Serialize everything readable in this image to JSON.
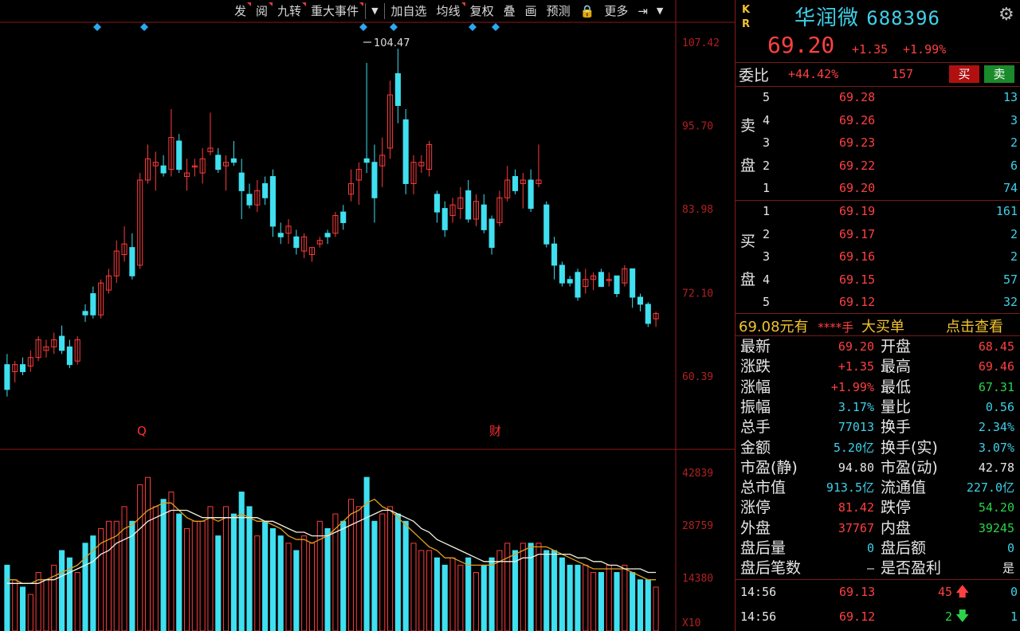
{
  "toolbar": {
    "items": [
      "发",
      "阅",
      "九转",
      "重大事件",
      "▼",
      "加自选",
      "均线",
      "复权",
      "叠",
      "画",
      "预测",
      "🔒",
      "更多",
      "⇥",
      "▼"
    ]
  },
  "chart": {
    "price_axis_labels": [
      "107.42",
      "95.70",
      "83.98",
      "72.10",
      "60.39"
    ],
    "volume_axis_labels": [
      "42839",
      "28759",
      "14380",
      "X10"
    ],
    "high_annotation": "104.47",
    "event_markers": [
      "Q",
      "财"
    ]
  },
  "chart_data": {
    "type": "candlestick",
    "ylim": [
      55,
      110
    ],
    "candles": [
      {
        "o": 62.0,
        "h": 63.5,
        "l": 57.5,
        "c": 58.5
      },
      {
        "o": 61.0,
        "h": 62.5,
        "l": 59.5,
        "c": 62.0
      },
      {
        "o": 62.0,
        "h": 63.0,
        "l": 60.5,
        "c": 61.0
      },
      {
        "o": 61.8,
        "h": 64.0,
        "l": 61.0,
        "c": 63.0
      },
      {
        "o": 63.0,
        "h": 66.0,
        "l": 62.5,
        "c": 65.5
      },
      {
        "o": 64.0,
        "h": 65.5,
        "l": 63.0,
        "c": 64.5
      },
      {
        "o": 64.5,
        "h": 66.5,
        "l": 63.5,
        "c": 65.5
      },
      {
        "o": 66.0,
        "h": 67.5,
        "l": 63.5,
        "c": 64.0
      },
      {
        "o": 64.5,
        "h": 65.5,
        "l": 61.5,
        "c": 62.0
      },
      {
        "o": 62.5,
        "h": 66.0,
        "l": 62.0,
        "c": 65.5
      },
      {
        "o": 69.5,
        "h": 70.5,
        "l": 68.0,
        "c": 69.0
      },
      {
        "o": 72.0,
        "h": 73.0,
        "l": 68.5,
        "c": 69.0
      },
      {
        "o": 69.0,
        "h": 74.0,
        "l": 68.5,
        "c": 73.5
      },
      {
        "o": 72.5,
        "h": 75.5,
        "l": 72.0,
        "c": 74.5
      },
      {
        "o": 74.5,
        "h": 79.5,
        "l": 73.5,
        "c": 78.0
      },
      {
        "o": 77.5,
        "h": 81.5,
        "l": 76.5,
        "c": 79.0
      },
      {
        "o": 78.5,
        "h": 80.5,
        "l": 74.0,
        "c": 74.5
      },
      {
        "o": 76.0,
        "h": 89.0,
        "l": 75.5,
        "c": 88.0
      },
      {
        "o": 88.0,
        "h": 93.0,
        "l": 87.5,
        "c": 91.0
      },
      {
        "o": 90.0,
        "h": 92.0,
        "l": 86.5,
        "c": 90.5
      },
      {
        "o": 90.0,
        "h": 91.5,
        "l": 88.5,
        "c": 89.0
      },
      {
        "o": 89.5,
        "h": 98.0,
        "l": 88.5,
        "c": 94.0
      },
      {
        "o": 93.5,
        "h": 94.5,
        "l": 89.0,
        "c": 89.5
      },
      {
        "o": 88.5,
        "h": 91.0,
        "l": 86.5,
        "c": 89.0
      },
      {
        "o": 90.0,
        "h": 91.0,
        "l": 88.5,
        "c": 90.0
      },
      {
        "o": 89.0,
        "h": 92.5,
        "l": 87.5,
        "c": 91.0
      },
      {
        "o": 92.0,
        "h": 97.5,
        "l": 91.5,
        "c": 92.5
      },
      {
        "o": 91.5,
        "h": 92.5,
        "l": 89.0,
        "c": 89.5
      },
      {
        "o": 90.0,
        "h": 91.5,
        "l": 86.5,
        "c": 90.5
      },
      {
        "o": 91.0,
        "h": 93.5,
        "l": 90.0,
        "c": 90.5
      },
      {
        "o": 89.0,
        "h": 91.0,
        "l": 82.5,
        "c": 86.5
      },
      {
        "o": 86.0,
        "h": 87.5,
        "l": 84.0,
        "c": 84.5
      },
      {
        "o": 84.5,
        "h": 88.0,
        "l": 83.5,
        "c": 86.5
      },
      {
        "o": 87.5,
        "h": 88.5,
        "l": 84.5,
        "c": 85.5
      },
      {
        "o": 88.5,
        "h": 89.5,
        "l": 80.0,
        "c": 81.5
      },
      {
        "o": 80.5,
        "h": 82.0,
        "l": 79.0,
        "c": 80.0
      },
      {
        "o": 80.5,
        "h": 82.5,
        "l": 79.0,
        "c": 81.5
      },
      {
        "o": 80.0,
        "h": 81.0,
        "l": 77.5,
        "c": 78.5
      },
      {
        "o": 78.0,
        "h": 80.5,
        "l": 77.0,
        "c": 80.0
      },
      {
        "o": 77.5,
        "h": 78.5,
        "l": 76.5,
        "c": 78.5
      },
      {
        "o": 79.0,
        "h": 80.0,
        "l": 78.5,
        "c": 79.5
      },
      {
        "o": 80.5,
        "h": 81.0,
        "l": 79.0,
        "c": 80.0
      },
      {
        "o": 80.5,
        "h": 83.5,
        "l": 80.0,
        "c": 83.0
      },
      {
        "o": 83.5,
        "h": 84.5,
        "l": 81.0,
        "c": 82.0
      },
      {
        "o": 86.0,
        "h": 89.5,
        "l": 85.0,
        "c": 87.5
      },
      {
        "o": 88.0,
        "h": 90.5,
        "l": 84.5,
        "c": 89.5
      },
      {
        "o": 91.0,
        "h": 104.5,
        "l": 89.0,
        "c": 90.5
      },
      {
        "o": 90.5,
        "h": 93.0,
        "l": 82.0,
        "c": 85.5
      },
      {
        "o": 90.0,
        "h": 94.0,
        "l": 87.0,
        "c": 91.5
      },
      {
        "o": 92.5,
        "h": 102.0,
        "l": 91.0,
        "c": 100.0
      },
      {
        "o": 103.0,
        "h": 106.5,
        "l": 96.0,
        "c": 98.5
      },
      {
        "o": 96.5,
        "h": 98.0,
        "l": 86.0,
        "c": 87.5
      },
      {
        "o": 87.5,
        "h": 91.5,
        "l": 86.0,
        "c": 90.5
      },
      {
        "o": 90.0,
        "h": 91.5,
        "l": 89.0,
        "c": 90.5
      },
      {
        "o": 89.5,
        "h": 93.5,
        "l": 88.5,
        "c": 93.0
      },
      {
        "o": 86.0,
        "h": 86.5,
        "l": 82.0,
        "c": 83.5
      },
      {
        "o": 84.0,
        "h": 85.0,
        "l": 80.0,
        "c": 81.0
      },
      {
        "o": 83.0,
        "h": 85.5,
        "l": 82.0,
        "c": 84.5
      },
      {
        "o": 84.0,
        "h": 87.0,
        "l": 82.5,
        "c": 85.5
      },
      {
        "o": 86.5,
        "h": 88.0,
        "l": 82.0,
        "c": 82.5
      },
      {
        "o": 82.5,
        "h": 86.0,
        "l": 81.5,
        "c": 85.0
      },
      {
        "o": 84.5,
        "h": 86.0,
        "l": 80.5,
        "c": 81.0
      },
      {
        "o": 82.5,
        "h": 83.0,
        "l": 77.5,
        "c": 78.5
      },
      {
        "o": 82.0,
        "h": 86.5,
        "l": 81.5,
        "c": 85.5
      },
      {
        "o": 85.5,
        "h": 90.0,
        "l": 85.0,
        "c": 88.0
      },
      {
        "o": 88.5,
        "h": 89.5,
        "l": 86.0,
        "c": 86.5
      },
      {
        "o": 87.5,
        "h": 89.0,
        "l": 84.0,
        "c": 88.0
      },
      {
        "o": 88.0,
        "h": 89.5,
        "l": 83.5,
        "c": 84.0
      },
      {
        "o": 87.5,
        "h": 93.0,
        "l": 87.0,
        "c": 88.0
      },
      {
        "o": 84.5,
        "h": 85.0,
        "l": 78.5,
        "c": 79.0
      },
      {
        "o": 79.0,
        "h": 80.0,
        "l": 74.0,
        "c": 76.0
      },
      {
        "o": 76.0,
        "h": 76.5,
        "l": 73.0,
        "c": 73.5
      },
      {
        "o": 74.0,
        "h": 74.5,
        "l": 73.0,
        "c": 73.5
      },
      {
        "o": 75.0,
        "h": 75.5,
        "l": 71.0,
        "c": 71.5
      },
      {
        "o": 73.0,
        "h": 75.5,
        "l": 72.0,
        "c": 74.0
      },
      {
        "o": 74.0,
        "h": 75.0,
        "l": 72.5,
        "c": 74.5
      },
      {
        "o": 75.0,
        "h": 75.5,
        "l": 73.0,
        "c": 73.0
      },
      {
        "o": 74.0,
        "h": 75.0,
        "l": 73.0,
        "c": 74.0
      },
      {
        "o": 74.5,
        "h": 74.5,
        "l": 71.5,
        "c": 72.0
      },
      {
        "o": 73.5,
        "h": 76.0,
        "l": 73.0,
        "c": 75.5
      },
      {
        "o": 75.5,
        "h": 75.5,
        "l": 70.0,
        "c": 71.5
      },
      {
        "o": 71.5,
        "h": 72.0,
        "l": 69.5,
        "c": 70.5
      },
      {
        "o": 70.5,
        "h": 70.8,
        "l": 67.3,
        "c": 67.8
      },
      {
        "o": 68.45,
        "h": 69.46,
        "l": 67.31,
        "c": 69.2
      }
    ],
    "volume": [
      18,
      14,
      12,
      10,
      16,
      14,
      18,
      22,
      20,
      16,
      24,
      26,
      28,
      30,
      30,
      34,
      30,
      40,
      42,
      34,
      36,
      38,
      32,
      28,
      30,
      30,
      34,
      26,
      34,
      32,
      38,
      34,
      26,
      30,
      28,
      26,
      24,
      22,
      26,
      24,
      30,
      28,
      32,
      30,
      36,
      34,
      42,
      30,
      32,
      34,
      32,
      30,
      24,
      22,
      22,
      20,
      18,
      20,
      18,
      20,
      16,
      18,
      20,
      22,
      24,
      22,
      24,
      24,
      24,
      22,
      22,
      20,
      18,
      18,
      18,
      16,
      16,
      18,
      16,
      18,
      16,
      14,
      14,
      12
    ],
    "ma5_volume": [
      14,
      14,
      13,
      13,
      14,
      14,
      15,
      16,
      17,
      18,
      20,
      22,
      24,
      25,
      26,
      28,
      29,
      31,
      33,
      34,
      35,
      35,
      33,
      31,
      30,
      30,
      31,
      30,
      31,
      31,
      32,
      31,
      30,
      30,
      29,
      28,
      26,
      25,
      25,
      24,
      25,
      26,
      28,
      30,
      32,
      33,
      35,
      36,
      34,
      33,
      31,
      29,
      27,
      25,
      23,
      22,
      20,
      20,
      19,
      18,
      18,
      18,
      18,
      19,
      20,
      21,
      22,
      23,
      23,
      23,
      22,
      21,
      20,
      19,
      18,
      17,
      17,
      17,
      17,
      17,
      16,
      15,
      14,
      14
    ],
    "ma10_volume": [
      13,
      13,
      13,
      13,
      13,
      14,
      14,
      15,
      16,
      17,
      18,
      19,
      21,
      22,
      24,
      25,
      26,
      28,
      30,
      31,
      32,
      33,
      33,
      33,
      32,
      31,
      31,
      31,
      31,
      31,
      31,
      31,
      31,
      30,
      30,
      29,
      28,
      27,
      27,
      26,
      26,
      26,
      27,
      28,
      29,
      30,
      31,
      32,
      33,
      33,
      32,
      31,
      30,
      28,
      27,
      25,
      24,
      23,
      22,
      21,
      20,
      19,
      19,
      19,
      19,
      19,
      20,
      20,
      21,
      21,
      21,
      21,
      21,
      20,
      20,
      19,
      19,
      18,
      18,
      17,
      17,
      17,
      16,
      16
    ],
    "volume_ylim": [
      0,
      44
    ]
  },
  "quote": {
    "kr_label": [
      "K",
      "R"
    ],
    "name": "华润微",
    "code": "688396",
    "last": "69.20",
    "change": "+1.35",
    "change_pct": "+1.99%"
  },
  "orderbook": {
    "weibi_label": "委比",
    "weibi_value": "+44.42%",
    "weibi_diff": "157",
    "buy_btn": "买",
    "sell_btn": "卖",
    "sell_side_label": [
      "卖",
      "盘"
    ],
    "buy_side_label": [
      "买",
      "盘"
    ],
    "asks": [
      {
        "lvl": "5",
        "price": "69.28",
        "vol": "13"
      },
      {
        "lvl": "4",
        "price": "69.26",
        "vol": "3"
      },
      {
        "lvl": "3",
        "price": "69.23",
        "vol": "2"
      },
      {
        "lvl": "2",
        "price": "69.22",
        "vol": "6"
      },
      {
        "lvl": "1",
        "price": "69.20",
        "vol": "74"
      }
    ],
    "bids": [
      {
        "lvl": "1",
        "price": "69.19",
        "vol": "161"
      },
      {
        "lvl": "2",
        "price": "69.17",
        "vol": "2"
      },
      {
        "lvl": "3",
        "price": "69.16",
        "vol": "2"
      },
      {
        "lvl": "4",
        "price": "69.15",
        "vol": "57"
      },
      {
        "lvl": "5",
        "price": "69.12",
        "vol": "32"
      }
    ]
  },
  "bigorder": {
    "text1": "69.08元有",
    "text2": "****手",
    "text3": "大买单",
    "link": "点击查看"
  },
  "stats": [
    {
      "k": "最新",
      "v": "69.20",
      "c": "red"
    },
    {
      "k": "开盘",
      "v": "68.45",
      "c": "red"
    },
    {
      "k": "涨跌",
      "v": "+1.35",
      "c": "red"
    },
    {
      "k": "最高",
      "v": "69.46",
      "c": "red"
    },
    {
      "k": "涨幅",
      "v": "+1.99%",
      "c": "red"
    },
    {
      "k": "最低",
      "v": "67.31",
      "c": "grn"
    },
    {
      "k": "振幅",
      "v": "3.17%",
      "c": "cyan"
    },
    {
      "k": "量比",
      "v": "0.56",
      "c": "cyan"
    },
    {
      "k": "总手",
      "v": "77013",
      "c": "cyan"
    },
    {
      "k": "换手",
      "v": "2.34%",
      "c": "cyan"
    },
    {
      "k": "金额",
      "v": "5.20亿",
      "c": "cyan"
    },
    {
      "k": "换手(实)",
      "v": "3.07%",
      "c": "cyan"
    },
    {
      "k": "市盈(静)",
      "v": "94.80",
      "c": "wht"
    },
    {
      "k": "市盈(动)",
      "v": "42.78",
      "c": "wht"
    },
    {
      "k": "总市值",
      "v": "913.5亿",
      "c": "cyan"
    },
    {
      "k": "流通值",
      "v": "227.0亿",
      "c": "cyan"
    },
    {
      "k": "涨停",
      "v": "81.42",
      "c": "red"
    },
    {
      "k": "跌停",
      "v": "54.20",
      "c": "grn"
    },
    {
      "k": "外盘",
      "v": "37767",
      "c": "red"
    },
    {
      "k": "内盘",
      "v": "39245",
      "c": "grn"
    },
    {
      "k": "盘后量",
      "v": "0",
      "c": "cyan"
    },
    {
      "k": "盘后额",
      "v": "0",
      "c": "cyan"
    },
    {
      "k": "盘后笔数",
      "v": "–",
      "c": "wht"
    },
    {
      "k": "是否盈利",
      "v": "是",
      "c": "wht"
    }
  ],
  "ticks": [
    {
      "time": "14:56",
      "price": "69.13",
      "vol": "45",
      "dir": "up",
      "count": "0"
    },
    {
      "time": "14:56",
      "price": "69.12",
      "vol": "2",
      "dir": "down",
      "count": "1"
    }
  ],
  "colors": {
    "up": "#ff3b3b",
    "down": "#3fe0f0",
    "ma5": "#e0a020",
    "ma10": "#f0f0e0",
    "grid": "#8b1a1a"
  }
}
